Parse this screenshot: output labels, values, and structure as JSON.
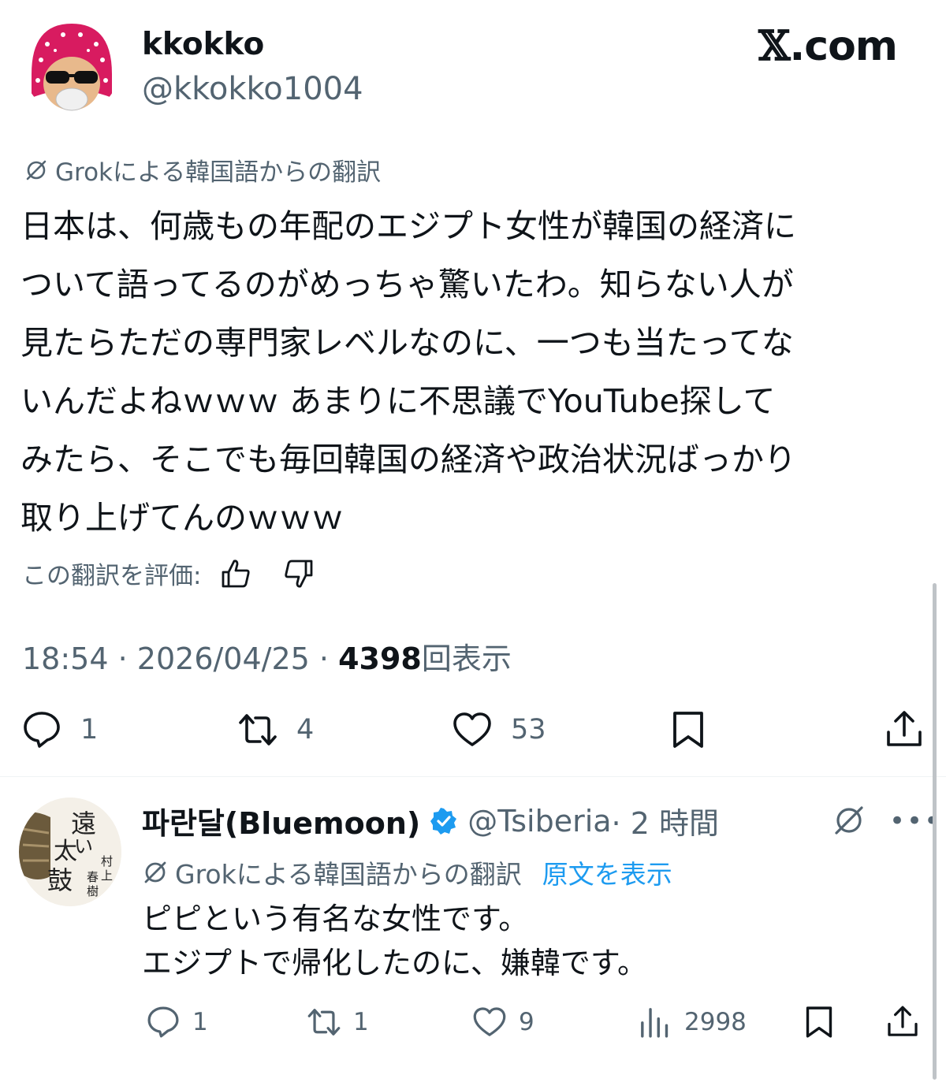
{
  "site_logo": {
    "mark": "𝕏",
    "text": ".com"
  },
  "tweet": {
    "display_name": "kkokko",
    "handle": "@kkokko1004",
    "translation_note": "Grokによる韓国語からの翻訳",
    "body": "日本は、何歳もの年配のエジプト女性が韓国の経済に\nついて語ってるのがめっちゃ驚いたわ。知らない人が\n見たらただの専門家レベルなのに、一つも当たってな\nいんだよねｗｗｗ あまりに不思議でYouTube探して\nみたら、そこでも毎回韓国の経済や政治状況ばっかり\n取り上げてんのｗｗｗ",
    "rate_label": "この翻訳を評価:",
    "time": "18:54",
    "date": "2026/04/25",
    "views_count": "4398",
    "views_label": "回表示",
    "separator": "·",
    "counts": {
      "replies": "1",
      "retweets": "4",
      "likes": "53"
    }
  },
  "reply": {
    "display_name": "파란달(Bluemoon)",
    "handle": "@Tsiberia",
    "time_ago": "· 2 時間",
    "translation_note": "Grokによる韓国語からの翻訳",
    "show_original": "原文を表示",
    "body": "ピピという有名な女性です。\nエジプトで帰化したのに、嫌韓です。",
    "more": "•••",
    "counts": {
      "replies": "1",
      "retweets": "1",
      "likes": "9",
      "views": "2998"
    }
  },
  "colors": {
    "text": "#0f1419",
    "secondary": "#536471",
    "link": "#1d9bf0",
    "verified": "#1d9bf0",
    "avatar_pink": "#d81b60"
  }
}
